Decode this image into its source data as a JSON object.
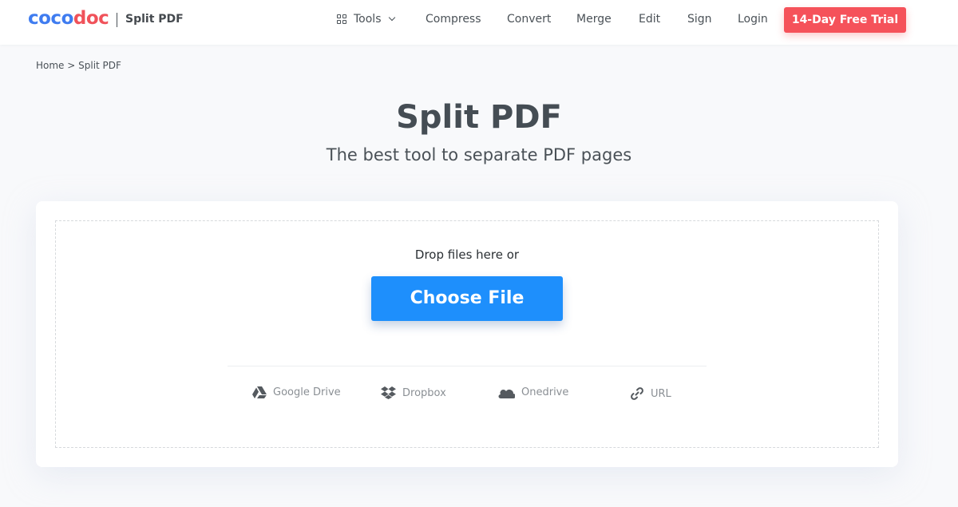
{
  "header": {
    "logo_part1": "coco",
    "logo_part2": "doc",
    "page_name": "Split PDF",
    "nav": {
      "tools": "Tools",
      "compress": "Compress",
      "convert": "Convert",
      "merge": "Merge",
      "edit": "Edit",
      "sign": "Sign",
      "login": "Login"
    },
    "trial_button": "14-Day Free Trial"
  },
  "breadcrumb": "Home > Split PDF",
  "main": {
    "title": "Split PDF",
    "subtitle": "The best tool to separate PDF pages",
    "drop_text": "Drop files here or",
    "choose_button": "Choose File",
    "sources": [
      {
        "label": "Google Drive",
        "icon": "google-drive-icon"
      },
      {
        "label": "Dropbox",
        "icon": "dropbox-icon"
      },
      {
        "label": "Onedrive",
        "icon": "onedrive-icon"
      },
      {
        "label": "URL",
        "icon": "link-icon"
      }
    ]
  },
  "colors": {
    "brand_blue": "#3f7cf0",
    "brand_red": "#f0525a",
    "trial_button": "#f5525a",
    "choose_button": "#1e8ffc"
  }
}
